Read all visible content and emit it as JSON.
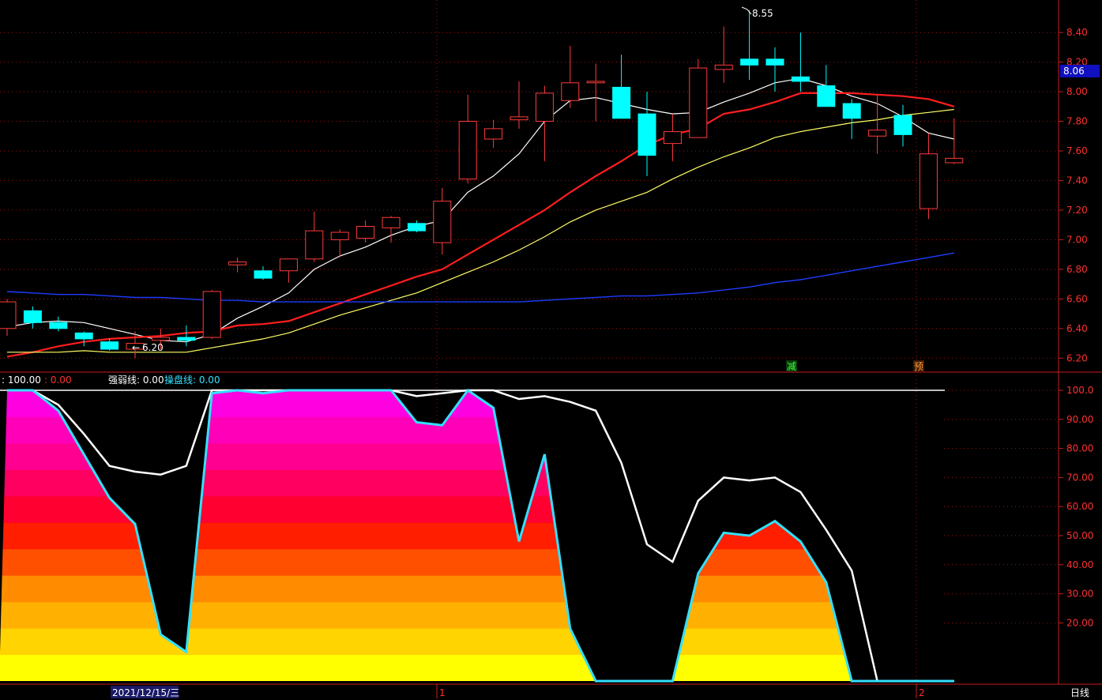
{
  "colors": {
    "background": "#000000",
    "frame": "#c81e1e",
    "grid": "#a01414",
    "up_candle": "#ff3b3b",
    "down_candle": "#00ffff",
    "ma5": "#ffffff",
    "ma10": "#ff1e1e",
    "ma20": "#ffff66",
    "ma60": "#1e3cff",
    "current_price_box": "#1010c0",
    "white_line": "#ffffff",
    "cyan_line": "#33e0ff",
    "fill_bands": [
      "#ffff00",
      "#ffd400",
      "#ffb000",
      "#ff8c00",
      "#ff5000",
      "#ff1e00",
      "#ff0030",
      "#ff0060",
      "#ff0090",
      "#ff00b8",
      "#ff00e0"
    ]
  },
  "top_indicator_text": {
    "strength_label": "强弱线: 0.00",
    "bull_value": ": 100.00",
    "bear_value": ": 0.00",
    "operate_label": "操盘线: 0.00"
  },
  "signals": {
    "reduce": "减",
    "warn": "预"
  },
  "annotations": {
    "high_price": "8.55",
    "low_price": "6.20"
  },
  "current_price": "8.06",
  "bottom_bar": {
    "date_marker": "2021/12/15/三",
    "month_1": "1",
    "month_2": "2",
    "period": "日线"
  },
  "chart_data": [
    {
      "type": "candlestick",
      "ylim": [
        6.1,
        8.55
      ],
      "y_ticks": [
        "8.40",
        "8.20",
        "8.00",
        "7.80",
        "7.60",
        "7.40",
        "7.20",
        "7.00",
        "6.80",
        "6.60",
        "6.40",
        "6.20"
      ],
      "candles": [
        {
          "o": 6.4,
          "h": 6.6,
          "l": 6.35,
          "c": 6.58
        },
        {
          "o": 6.52,
          "h": 6.55,
          "l": 6.4,
          "c": 6.44
        },
        {
          "o": 6.44,
          "h": 6.48,
          "l": 6.38,
          "c": 6.4
        },
        {
          "o": 6.37,
          "h": 6.38,
          "l": 6.28,
          "c": 6.33
        },
        {
          "o": 6.31,
          "h": 6.33,
          "l": 6.25,
          "c": 6.26
        },
        {
          "o": 6.26,
          "h": 6.38,
          "l": 6.2,
          "c": 6.3
        },
        {
          "o": 6.32,
          "h": 6.4,
          "l": 6.26,
          "c": 6.34
        },
        {
          "o": 6.34,
          "h": 6.42,
          "l": 6.28,
          "c": 6.32
        },
        {
          "o": 6.34,
          "h": 6.66,
          "l": 6.33,
          "c": 6.65
        },
        {
          "o": 6.83,
          "h": 6.88,
          "l": 6.78,
          "c": 6.85
        },
        {
          "o": 6.79,
          "h": 6.82,
          "l": 6.73,
          "c": 6.74
        },
        {
          "o": 6.79,
          "h": 6.87,
          "l": 6.71,
          "c": 6.87
        },
        {
          "o": 6.87,
          "h": 7.19,
          "l": 6.85,
          "c": 7.06
        },
        {
          "o": 7.0,
          "h": 7.07,
          "l": 6.88,
          "c": 7.05
        },
        {
          "o": 7.01,
          "h": 7.13,
          "l": 6.98,
          "c": 7.09
        },
        {
          "o": 7.08,
          "h": 7.16,
          "l": 6.98,
          "c": 7.15
        },
        {
          "o": 7.11,
          "h": 7.13,
          "l": 7.05,
          "c": 7.06
        },
        {
          "o": 6.98,
          "h": 7.35,
          "l": 6.9,
          "c": 7.26
        },
        {
          "o": 7.41,
          "h": 7.98,
          "l": 7.38,
          "c": 7.8
        },
        {
          "o": 7.68,
          "h": 7.81,
          "l": 7.62,
          "c": 7.75
        },
        {
          "o": 7.81,
          "h": 8.07,
          "l": 7.75,
          "c": 7.83
        },
        {
          "o": 7.8,
          "h": 8.04,
          "l": 7.53,
          "c": 7.99
        },
        {
          "o": 7.94,
          "h": 8.31,
          "l": 7.89,
          "c": 8.06
        },
        {
          "o": 8.06,
          "h": 8.19,
          "l": 7.8,
          "c": 8.07
        },
        {
          "o": 8.03,
          "h": 8.25,
          "l": 7.9,
          "c": 7.82
        },
        {
          "o": 7.85,
          "h": 8.0,
          "l": 7.43,
          "c": 7.57
        },
        {
          "o": 7.65,
          "h": 7.85,
          "l": 7.53,
          "c": 7.73
        },
        {
          "o": 7.69,
          "h": 8.22,
          "l": 7.69,
          "c": 8.16
        },
        {
          "o": 8.15,
          "h": 8.44,
          "l": 8.06,
          "c": 8.18
        },
        {
          "o": 8.22,
          "h": 8.55,
          "l": 8.08,
          "c": 8.18
        },
        {
          "o": 8.22,
          "h": 8.3,
          "l": 8.0,
          "c": 8.18
        },
        {
          "o": 8.1,
          "h": 8.4,
          "l": 8.0,
          "c": 8.07
        },
        {
          "o": 8.04,
          "h": 8.18,
          "l": 7.95,
          "c": 7.9
        },
        {
          "o": 7.92,
          "h": 7.95,
          "l": 7.68,
          "c": 7.82
        },
        {
          "o": 7.7,
          "h": 7.98,
          "l": 7.58,
          "c": 7.74
        },
        {
          "o": 7.84,
          "h": 7.91,
          "l": 7.63,
          "c": 7.71
        },
        {
          "o": 7.21,
          "h": 7.72,
          "l": 7.14,
          "c": 7.58
        },
        {
          "o": 7.52,
          "h": 7.82,
          "l": 7.51,
          "c": 7.55
        }
      ],
      "ma_lines": [
        {
          "id": "ma5",
          "values": [
            6.41,
            6.44,
            6.45,
            6.44,
            6.4,
            6.36,
            6.32,
            6.31,
            6.36,
            6.47,
            6.55,
            6.64,
            6.8,
            6.89,
            6.95,
            7.03,
            7.09,
            7.13,
            7.32,
            7.43,
            7.58,
            7.8,
            7.94,
            7.96,
            7.92,
            7.88,
            7.85,
            7.86,
            7.93,
            7.99,
            8.06,
            8.09,
            8.04,
            7.97,
            7.92,
            7.83,
            7.72,
            7.68
          ]
        },
        {
          "id": "ma10",
          "values": [
            6.21,
            6.24,
            6.28,
            6.31,
            6.33,
            6.34,
            6.35,
            6.37,
            6.38,
            6.42,
            6.43,
            6.45,
            6.51,
            6.57,
            6.63,
            6.69,
            6.75,
            6.8,
            6.9,
            7.0,
            7.1,
            7.2,
            7.32,
            7.43,
            7.53,
            7.64,
            7.71,
            7.75,
            7.85,
            7.88,
            7.93,
            7.99,
            7.99,
            7.99,
            7.98,
            7.97,
            7.95,
            7.9
          ]
        },
        {
          "id": "ma20",
          "values": [
            6.24,
            6.24,
            6.24,
            6.25,
            6.24,
            6.24,
            6.24,
            6.24,
            6.27,
            6.3,
            6.33,
            6.37,
            6.43,
            6.49,
            6.54,
            6.59,
            6.64,
            6.71,
            6.78,
            6.85,
            6.93,
            7.02,
            7.12,
            7.2,
            7.26,
            7.32,
            7.41,
            7.49,
            7.56,
            7.62,
            7.69,
            7.73,
            7.76,
            7.79,
            7.81,
            7.84,
            7.86,
            7.88
          ]
        },
        {
          "id": "ma60",
          "values": [
            6.65,
            6.64,
            6.63,
            6.63,
            6.62,
            6.61,
            6.61,
            6.6,
            6.59,
            6.59,
            6.58,
            6.58,
            6.58,
            6.58,
            6.58,
            6.58,
            6.58,
            6.58,
            6.58,
            6.58,
            6.58,
            6.59,
            6.6,
            6.61,
            6.62,
            6.62,
            6.63,
            6.64,
            6.66,
            6.68,
            6.71,
            6.73,
            6.76,
            6.79,
            6.82,
            6.85,
            6.88,
            6.91
          ]
        }
      ]
    },
    {
      "type": "area",
      "ylim": [
        0,
        100
      ],
      "y_ticks": [
        "100.0",
        "90.00",
        "80.00",
        "70.00",
        "60.00",
        "50.00",
        "40.00",
        "30.00",
        "20.00"
      ],
      "series": [
        {
          "id": "white_line",
          "values": [
            100,
            100,
            95,
            85,
            74,
            72,
            71,
            74,
            100,
            100,
            100,
            100,
            100,
            100,
            100,
            100,
            98,
            99,
            100,
            100,
            97,
            98,
            96,
            93,
            75,
            47,
            41,
            62,
            70,
            69,
            70,
            65,
            52,
            38,
            0,
            0,
            0,
            0
          ]
        },
        {
          "id": "cyan_line",
          "values": [
            100,
            100,
            93,
            78,
            63,
            54,
            16,
            10,
            99,
            100,
            99,
            100,
            100,
            100,
            100,
            100,
            89,
            88,
            100,
            94,
            48,
            78,
            18,
            0,
            0,
            0,
            0,
            37,
            51,
            50,
            55,
            48,
            34,
            0,
            0,
            0,
            0,
            0
          ]
        }
      ]
    }
  ]
}
